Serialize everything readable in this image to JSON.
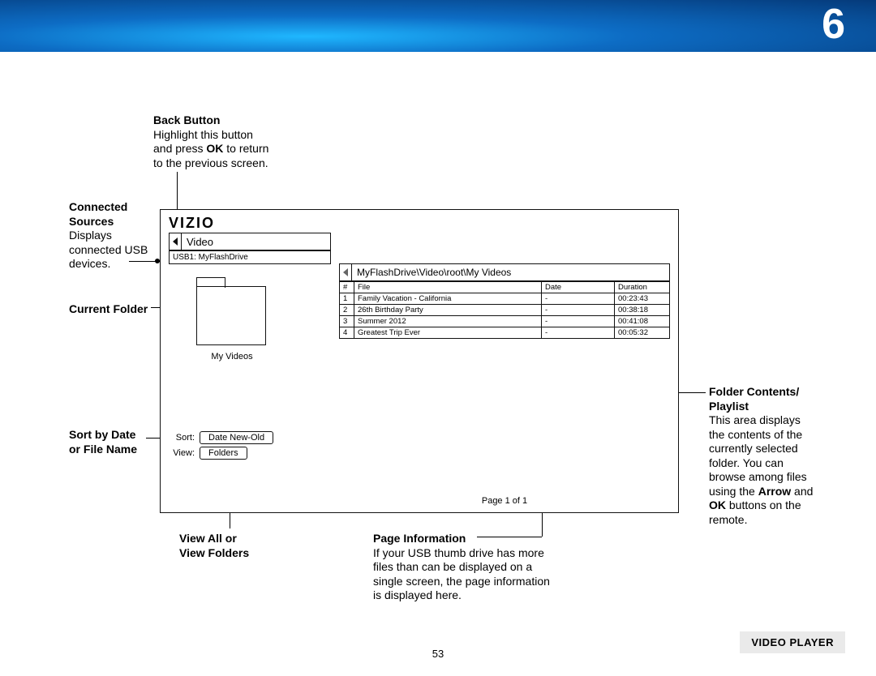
{
  "banner": {
    "number": "6"
  },
  "callouts": {
    "back_button": {
      "title": "Back Button",
      "body_1": "Highlight this button",
      "body_2": "and press ",
      "ok": "OK",
      "body_3": " to return",
      "body_4": "to the previous screen."
    },
    "connected_sources": {
      "title_1": "Connected",
      "title_2": "Sources",
      "body_1": "Displays",
      "body_2": "connected USB",
      "body_3": "devices."
    },
    "current_folder": {
      "title": "Current Folder"
    },
    "sort": {
      "title_1": "Sort by Date",
      "title_2": "or File Name"
    },
    "view": {
      "title_1": "View All or",
      "title_2": "View Folders"
    },
    "page_info": {
      "title": "Page Information",
      "body_1": "If your USB thumb drive has more",
      "body_2": "files than can be displayed on a",
      "body_3": "single screen, the page information",
      "body_4": "is displayed here."
    },
    "folder_contents": {
      "title_1": "Folder Contents/",
      "title_2": "Playlist",
      "body_1": "This area displays",
      "body_2": "the contents of the",
      "body_3": "currently selected",
      "body_4": "folder. You can",
      "body_5": "browse among files",
      "body_6": "using the ",
      "arrow": "Arrow",
      "body_7": " and",
      "ok": "OK",
      "body_8": " buttons on the",
      "body_9": "remote."
    }
  },
  "ui": {
    "logo": "VIZIO",
    "video_label": "Video",
    "usb_label": "USB1: MyFlashDrive",
    "folder_name": "My Videos",
    "sort_label": "Sort:",
    "sort_value": "Date New-Old",
    "view_label": "View:",
    "view_value": "Folders",
    "path": "MyFlashDrive\\Video\\root\\My Videos",
    "headers": {
      "num": "#",
      "file": "File",
      "date": "Date",
      "duration": "Duration"
    },
    "rows": [
      {
        "n": "1",
        "file": "Family Vacation - California",
        "date": "-",
        "dur": "00:23:43"
      },
      {
        "n": "2",
        "file": "26th Birthday Party",
        "date": "-",
        "dur": "00:38:18"
      },
      {
        "n": "3",
        "file": "Summer 2012",
        "date": "-",
        "dur": "00:41:08"
      },
      {
        "n": "4",
        "file": "Greatest Trip Ever",
        "date": "-",
        "dur": "00:05:32"
      }
    ],
    "page_info": "Page 1 of 1"
  },
  "footer": {
    "section": "VIDEO PLAYER",
    "page": "53"
  }
}
